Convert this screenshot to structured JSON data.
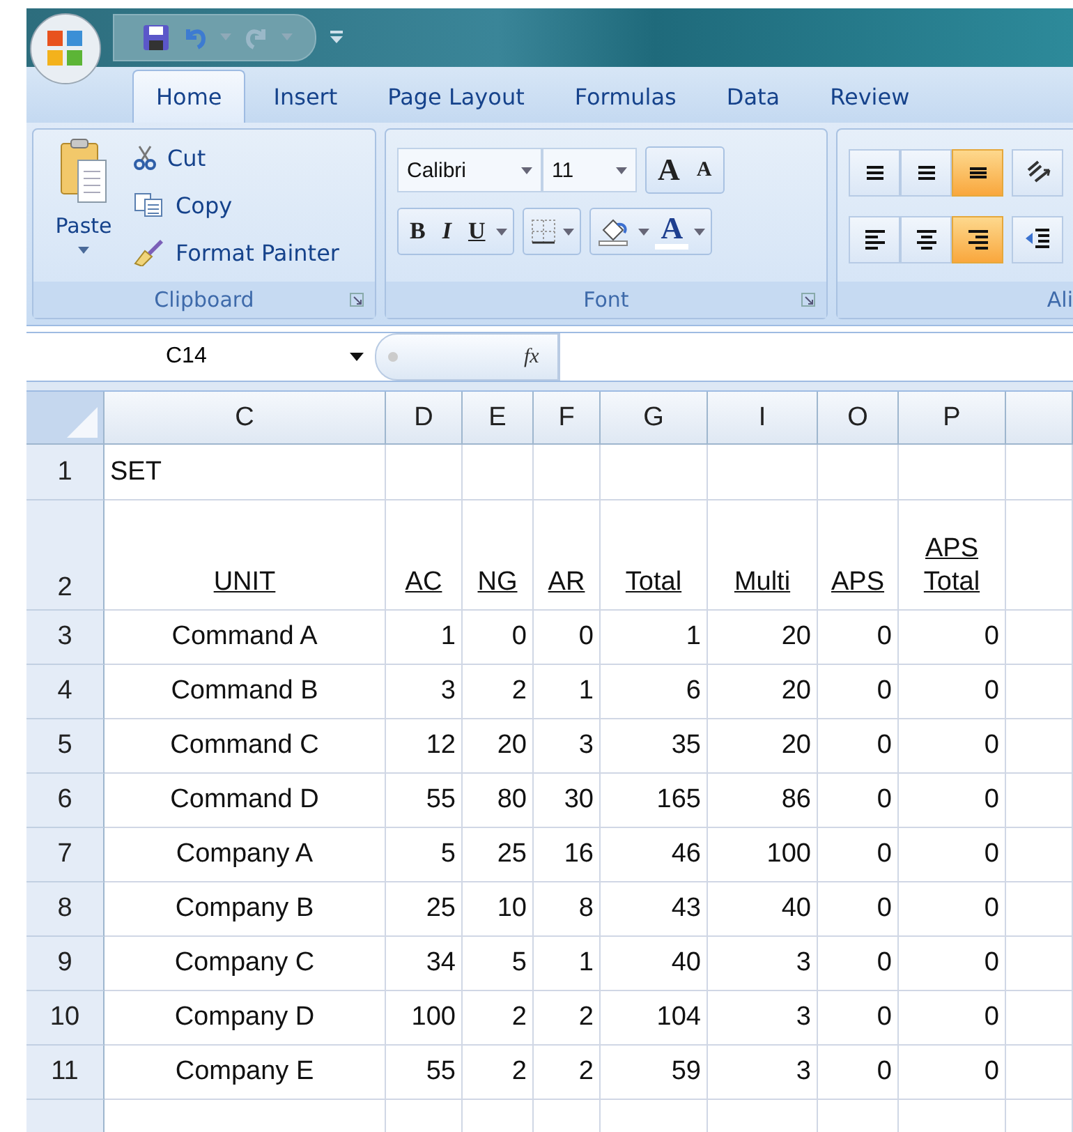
{
  "tabs": [
    {
      "label": "Home",
      "selected": true
    },
    {
      "label": "Insert",
      "selected": false
    },
    {
      "label": "Page Layout",
      "selected": false
    },
    {
      "label": "Formulas",
      "selected": false
    },
    {
      "label": "Data",
      "selected": false
    },
    {
      "label": "Review",
      "selected": false
    }
  ],
  "clipboard": {
    "paste": "Paste",
    "items": [
      {
        "kind": "cut",
        "label": "Cut"
      },
      {
        "kind": "copy",
        "label": "Copy"
      },
      {
        "kind": "painter",
        "label": "Format Painter"
      }
    ],
    "label": "Clipboard"
  },
  "font": {
    "name": "Calibri",
    "size": "11",
    "grow": "A",
    "shrink": "A",
    "bold": "B",
    "italic": "I",
    "underline": "U",
    "font_color": "A",
    "label": "Font"
  },
  "alignment": {
    "label": "Ali",
    "buttons": [
      {
        "kind": "top",
        "selected": false
      },
      {
        "kind": "middle",
        "selected": false
      },
      {
        "kind": "bottom",
        "selected": true
      },
      {
        "kind": "orientation",
        "selected": false
      },
      {
        "kind": "left",
        "selected": false
      },
      {
        "kind": "center",
        "selected": false
      },
      {
        "kind": "right",
        "selected": true
      },
      {
        "kind": "indent",
        "selected": false
      }
    ]
  },
  "formula_bar": {
    "name_box": "C14",
    "fx": "fx"
  },
  "sheet": {
    "columns": [
      "C",
      "D",
      "E",
      "F",
      "G",
      "I",
      "O",
      "P"
    ],
    "rows": [
      {
        "header": "1",
        "kind": "title",
        "text": "SET"
      },
      {
        "header": "2",
        "kind": "heading",
        "cells": [
          "UNIT",
          "AC",
          "NG",
          "AR",
          "Total",
          "Multi",
          "APS",
          "APS Total"
        ]
      },
      {
        "header": "3",
        "kind": "data",
        "cells": [
          "Command A",
          "1",
          "0",
          "0",
          "1",
          "20",
          "0",
          "0"
        ]
      },
      {
        "header": "4",
        "kind": "data",
        "cells": [
          "Command B",
          "3",
          "2",
          "1",
          "6",
          "20",
          "0",
          "0"
        ]
      },
      {
        "header": "5",
        "kind": "data",
        "cells": [
          "Command C",
          "12",
          "20",
          "3",
          "35",
          "20",
          "0",
          "0"
        ]
      },
      {
        "header": "6",
        "kind": "data",
        "cells": [
          "Command D",
          "55",
          "80",
          "30",
          "165",
          "86",
          "0",
          "0"
        ]
      },
      {
        "header": "7",
        "kind": "data",
        "cells": [
          "Company A",
          "5",
          "25",
          "16",
          "46",
          "100",
          "0",
          "0"
        ]
      },
      {
        "header": "8",
        "kind": "data",
        "cells": [
          "Company B",
          "25",
          "10",
          "8",
          "43",
          "40",
          "0",
          "0"
        ]
      },
      {
        "header": "9",
        "kind": "data",
        "cells": [
          "Company C",
          "34",
          "5",
          "1",
          "40",
          "3",
          "0",
          "0"
        ]
      },
      {
        "header": "10",
        "kind": "data",
        "cells": [
          "Company D",
          "100",
          "2",
          "2",
          "104",
          "3",
          "0",
          "0"
        ]
      },
      {
        "header": "11",
        "kind": "data",
        "cells": [
          "Company E",
          "55",
          "2",
          "2",
          "59",
          "3",
          "0",
          "0"
        ]
      }
    ]
  }
}
